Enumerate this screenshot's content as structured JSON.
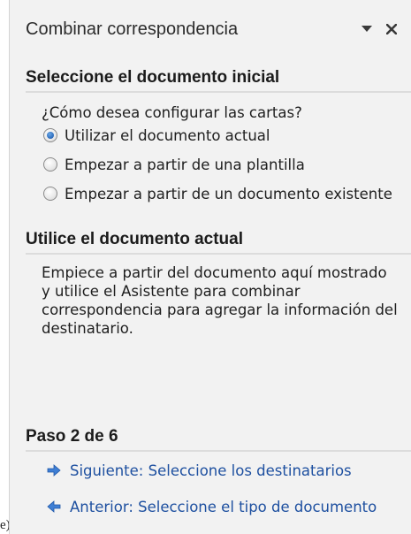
{
  "pane": {
    "title": "Combinar correspondencia",
    "icons": {
      "dropdown": "triangle-down-icon",
      "close": "close-icon"
    }
  },
  "section1": {
    "heading": "Seleccione el documento inicial",
    "question": "¿Cómo desea configurar las cartas?",
    "options": [
      {
        "label": "Utilizar el documento actual",
        "selected": true
      },
      {
        "label": "Empezar a partir de una plantilla",
        "selected": false
      },
      {
        "label": "Empezar a partir de un documento existente",
        "selected": false
      }
    ]
  },
  "section2": {
    "heading": "Utilice el documento actual",
    "description": "Empiece a partir del documento aquí mostrado y utilice el Asistente para combinar correspondencia para agregar la información del destinatario."
  },
  "wizard": {
    "step": "Paso 2 de 6",
    "next_label": "Siguiente: Seleccione los destinatarios",
    "prev_label": "Anterior: Seleccione el tipo de documento",
    "arrow_color": "#3f7fd4"
  },
  "page_mark": "e)"
}
